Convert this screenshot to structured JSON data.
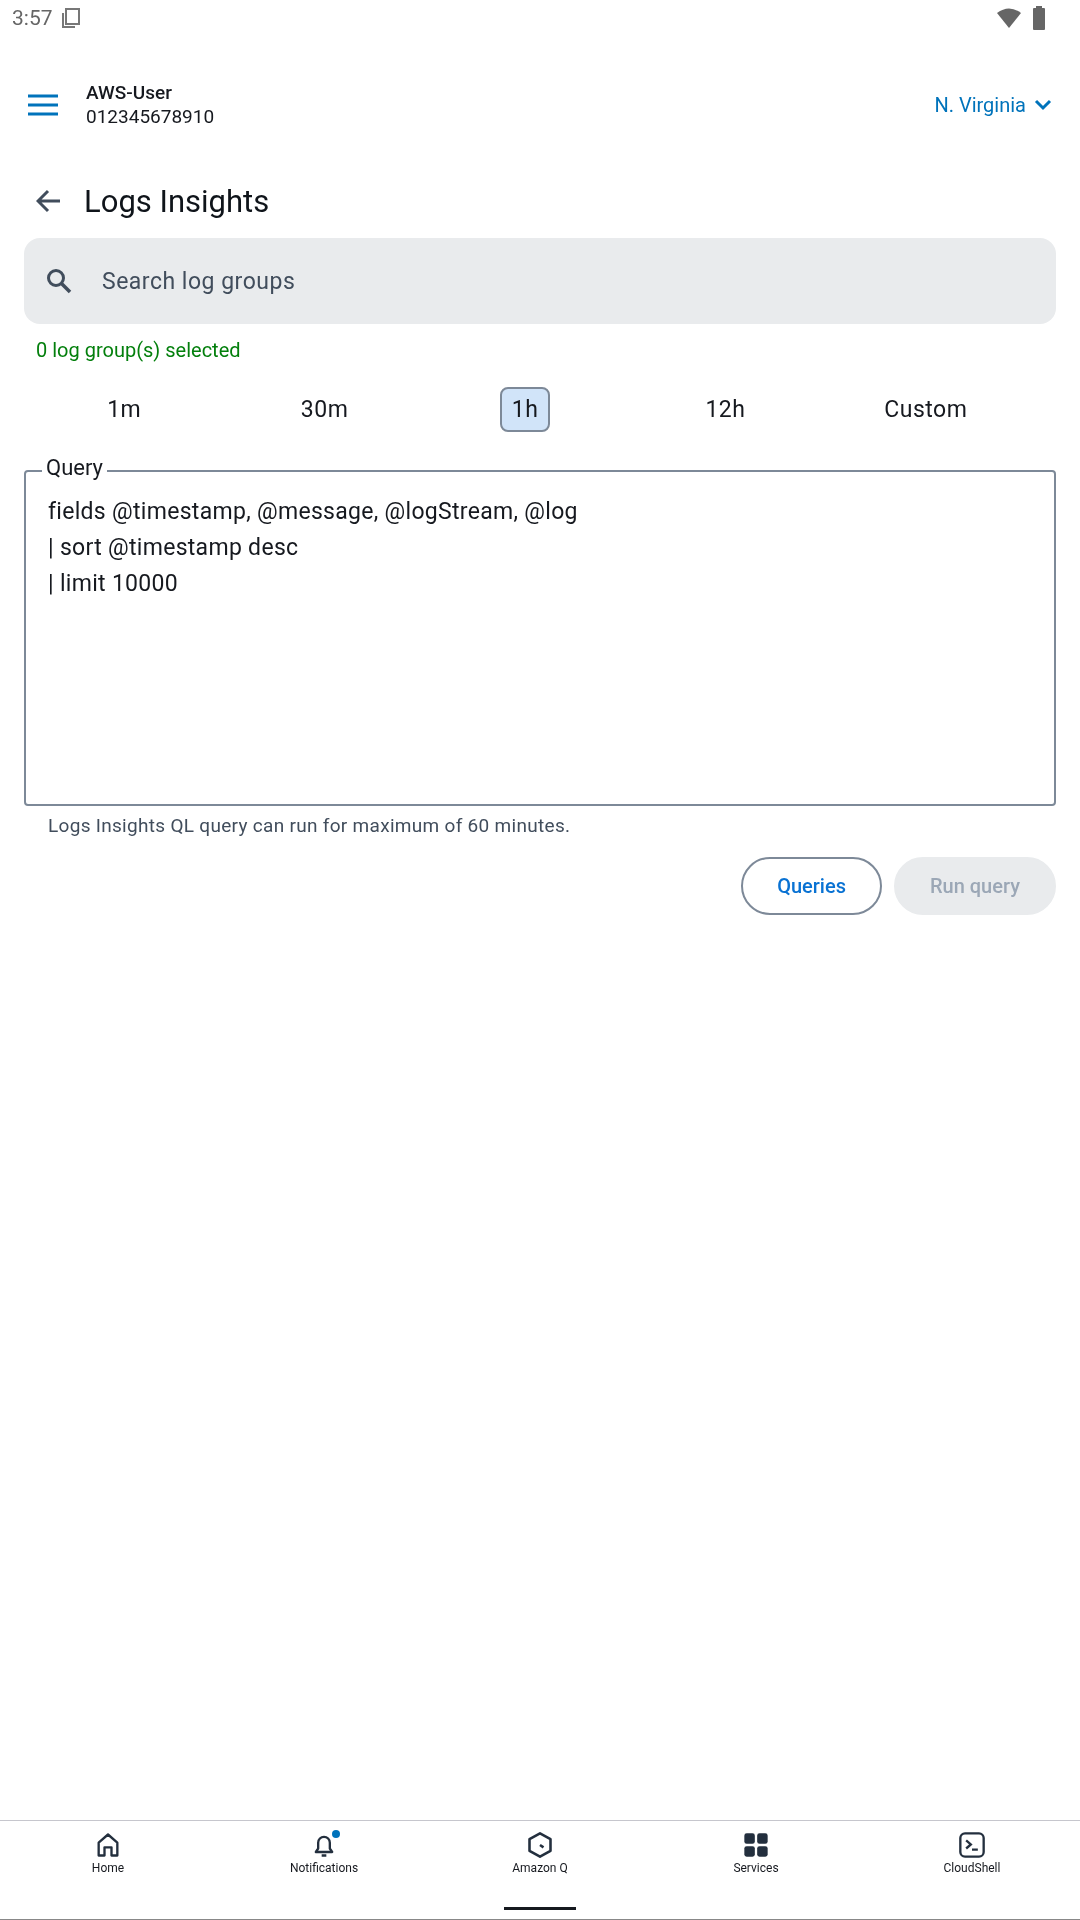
{
  "status_bar": {
    "time": "3:57"
  },
  "header": {
    "user": "AWS-User",
    "account": "012345678910",
    "region": "N. Virginia"
  },
  "page": {
    "title": "Logs Insights"
  },
  "search": {
    "placeholder": "Search log groups"
  },
  "selection_note": "0 log group(s) selected",
  "time_ranges": [
    {
      "label": "1m",
      "selected": false
    },
    {
      "label": "30m",
      "selected": false
    },
    {
      "label": "1h",
      "selected": true
    },
    {
      "label": "12h",
      "selected": false
    },
    {
      "label": "Custom",
      "selected": false
    }
  ],
  "query": {
    "label": "Query",
    "value": "fields @timestamp, @message, @logStream, @log\n| sort @timestamp desc\n| limit 10000",
    "helper": "Logs Insights QL query can run for maximum of 60 minutes."
  },
  "buttons": [
    {
      "label": "Queries",
      "kind": "outlined",
      "disabled": false
    },
    {
      "label": "Run query",
      "kind": "filled",
      "disabled": true
    }
  ],
  "bottom_nav": [
    {
      "label": "Home",
      "kind": "home",
      "dot": false
    },
    {
      "label": "Notifications",
      "kind": "bell",
      "dot": true
    },
    {
      "label": "Amazon Q",
      "kind": "hexagon",
      "dot": false
    },
    {
      "label": "Services",
      "kind": "grid",
      "dot": false
    },
    {
      "label": "CloudShell",
      "kind": "terminal",
      "dot": false
    }
  ]
}
